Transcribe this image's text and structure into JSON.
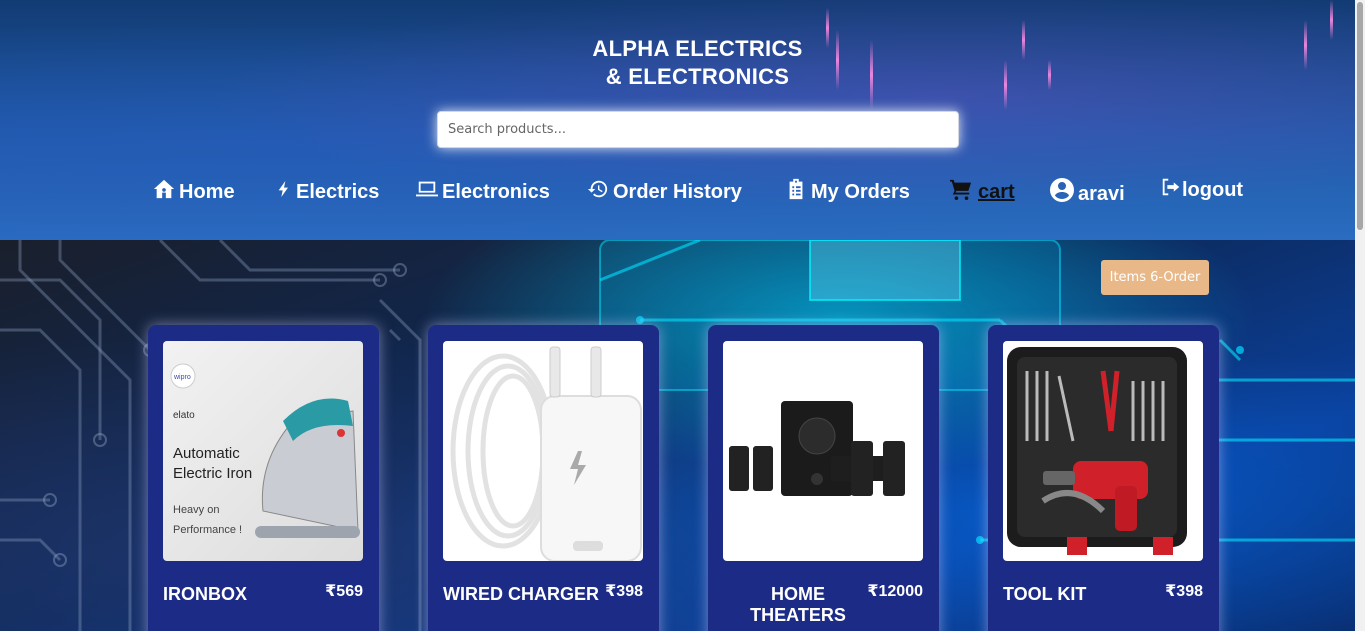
{
  "header": {
    "title_line1": "ALPHA ELECTRICS",
    "title_line2": "& ELECTRONICS"
  },
  "search": {
    "placeholder": "Search products...",
    "value": ""
  },
  "nav": {
    "home": "Home",
    "electrics": "Electrics",
    "electronics": "Electronics",
    "order_history": "Order History",
    "my_orders": "My Orders",
    "cart": "cart",
    "user": "aravi",
    "logout": "logout"
  },
  "badge": {
    "label": "Items 6-Order"
  },
  "products": [
    {
      "name": "IRONBOX",
      "price": "₹569",
      "image_text": [
        "wipro",
        "elato",
        "Automatic",
        "Electric Iron",
        "Heavy on",
        "Performance !"
      ]
    },
    {
      "name": "WIRED CHARGER",
      "price": "₹398"
    },
    {
      "name": "HOME THEATERS",
      "price": "₹12000"
    },
    {
      "name": "TOOL KIT",
      "price": "₹398"
    }
  ],
  "colors": {
    "card_bg": "#1c2b86",
    "badge_bg": "#e8b888",
    "header_top": "#123b73",
    "header_bottom": "#2a6cc0"
  },
  "icons": {
    "home": "home-icon",
    "electrics": "bolt-icon",
    "electronics": "laptop-icon",
    "order_history": "history-icon",
    "my_orders": "clipboard-icon",
    "cart": "cart-icon",
    "user": "user-circle-icon",
    "logout": "logout-icon"
  }
}
